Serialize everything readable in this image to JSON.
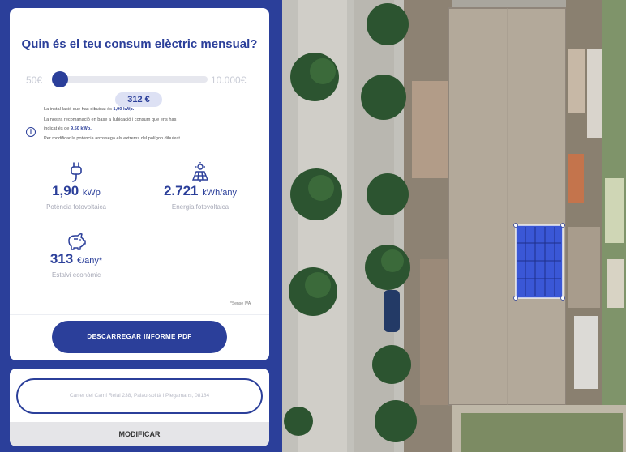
{
  "question": "Quin és el teu consum elèctric mensual?",
  "slider": {
    "min_label": "50€",
    "max_label": "10.000€",
    "value_label": "312 €",
    "level": 0.03
  },
  "info": {
    "line1_pre": "La instal·lació que has dibuixat és ",
    "line1_bold": "1,90 kWp.",
    "line2": "La nostra recomanació en base a l'ubicació i consum que ens has",
    "line3_pre": "indicat és de ",
    "line3_bold": "9,50 kWp.",
    "line4": "Per modificar la potència arrossega els extrems del polígon dibuixat."
  },
  "metrics": {
    "power": {
      "value": "1,90",
      "unit": "kWp",
      "caption": "Potència fotovoltaica",
      "icon": "plug-icon"
    },
    "energy": {
      "value": "2.721",
      "unit": "kWh/any",
      "caption": "Energia fotovoltaica",
      "icon": "solar-panel-icon"
    },
    "saving": {
      "value": "313",
      "unit": "€/any*",
      "caption": "Estalvi econòmic",
      "icon": "piggy-bank-icon"
    }
  },
  "footnote": "*Sense IVA",
  "pdf_button": "DESCARREGAR INFORME PDF",
  "address": "Carrer del Camí Reial 238, Palau-solità i Plegamans, 08184",
  "modify_button": "MODIFICAR",
  "colors": {
    "brand": "#2b3f9a",
    "solar_polygon": "#3a57d6",
    "roof": "#b3a99a"
  }
}
